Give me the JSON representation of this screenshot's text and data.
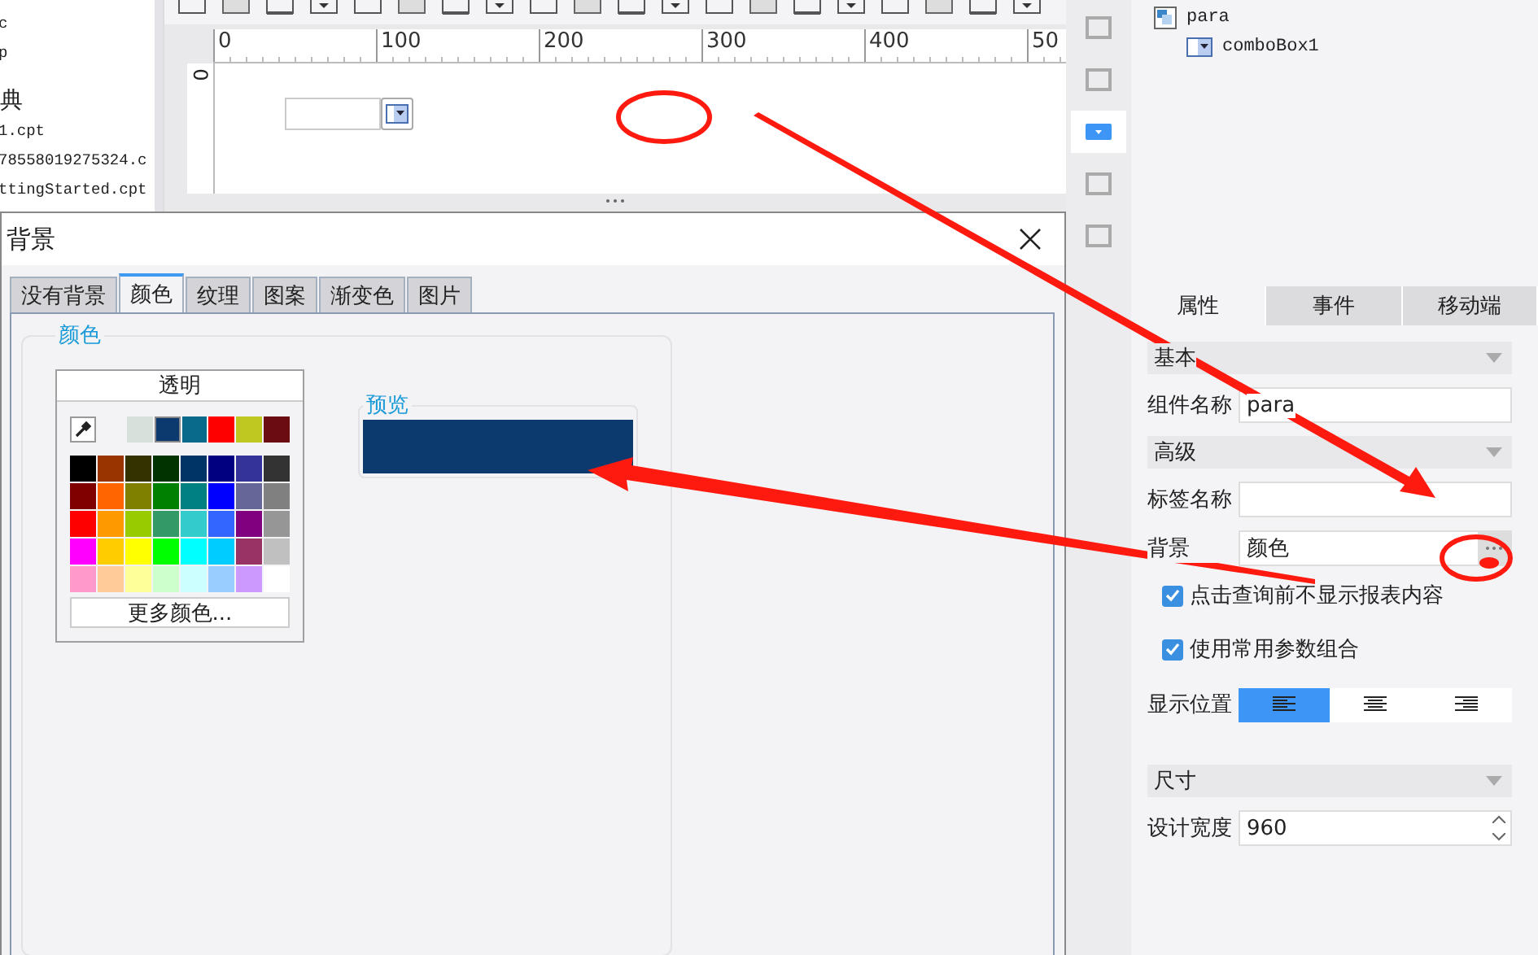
{
  "file_list": {
    "items": [
      "c",
      "p",
      "典",
      "1.cpt",
      "78558019275324.c",
      "ttingStarted.cpt"
    ]
  },
  "ruler": {
    "labels": [
      "0",
      "100",
      "200",
      "300",
      "400",
      "50"
    ],
    "vertical_label": "0"
  },
  "widget_strip": [
    {
      "selected": false
    },
    {
      "selected": false
    },
    {
      "selected": true
    },
    {
      "selected": false
    },
    {
      "selected": false
    }
  ],
  "tree": [
    {
      "label": "para",
      "children": [
        {
          "label": "comboBox1"
        }
      ]
    }
  ],
  "panel_tabs": [
    {
      "label": "属性",
      "selected": true
    },
    {
      "label": "事件",
      "selected": false
    },
    {
      "label": "移动端",
      "selected": false
    }
  ],
  "sections": [
    {
      "title": "基本",
      "expanded": true,
      "rows": [
        {
          "kind": "text",
          "label": "组件名称",
          "value": "para"
        }
      ]
    },
    {
      "title": "高级",
      "expanded": true,
      "rows": [
        {
          "kind": "text",
          "label": "标签名称"
        },
        {
          "kind": "picker",
          "label": "背景",
          "value": "颜色"
        },
        {
          "kind": "checkbox",
          "label": "点击查询前不显示报表内容",
          "checked": true
        },
        {
          "kind": "checkbox",
          "label": "使用常用参数组合",
          "checked": true
        },
        {
          "kind": "align",
          "label": "显示位置",
          "options": [
            {
              "selected": true
            },
            {
              "selected": false
            },
            {
              "selected": false
            }
          ]
        }
      ]
    },
    {
      "title": "尺寸",
      "expanded": true,
      "rows": [
        {
          "kind": "spinner",
          "label": "设计宽度",
          "value": "960"
        }
      ]
    }
  ],
  "dialog": {
    "title": "背景",
    "tabs": [
      {
        "label": "没有背景",
        "selected": false
      },
      {
        "label": "颜色",
        "selected": true
      },
      {
        "label": "纹理",
        "selected": false
      },
      {
        "label": "图案",
        "selected": false
      },
      {
        "label": "渐变色",
        "selected": false
      },
      {
        "label": "图片",
        "selected": false
      }
    ],
    "group_title": "颜色",
    "transparent_button": "透明",
    "recent_colors": [
      {
        "color": "#d8e0dc",
        "selected": false
      },
      {
        "color": "#0d3a6e",
        "selected": true
      },
      {
        "color": "#0a6a8c",
        "selected": false
      },
      {
        "color": "#ff0000",
        "selected": false
      },
      {
        "color": "#bec820",
        "selected": false
      },
      {
        "color": "#6a0c10",
        "selected": false
      }
    ],
    "palette": [
      [
        {
          "color": "#000000"
        },
        {
          "color": "#993300"
        },
        {
          "color": "#333300"
        },
        {
          "color": "#003300"
        },
        {
          "color": "#003366"
        },
        {
          "color": "#000080"
        },
        {
          "color": "#333399"
        },
        {
          "color": "#333333"
        }
      ],
      [
        {
          "color": "#800000"
        },
        {
          "color": "#ff6600"
        },
        {
          "color": "#808000"
        },
        {
          "color": "#008000"
        },
        {
          "color": "#008080"
        },
        {
          "color": "#0000ff"
        },
        {
          "color": "#666699"
        },
        {
          "color": "#808080"
        }
      ],
      [
        {
          "color": "#ff0000"
        },
        {
          "color": "#ff9900"
        },
        {
          "color": "#99cc00"
        },
        {
          "color": "#339966"
        },
        {
          "color": "#33cccc"
        },
        {
          "color": "#3366ff"
        },
        {
          "color": "#800080"
        },
        {
          "color": "#969696"
        }
      ],
      [
        {
          "color": "#ff00ff"
        },
        {
          "color": "#ffcc00"
        },
        {
          "color": "#ffff00"
        },
        {
          "color": "#00ff00"
        },
        {
          "color": "#00ffff"
        },
        {
          "color": "#00ccff"
        },
        {
          "color": "#993366"
        },
        {
          "color": "#c0c0c0"
        }
      ],
      [
        {
          "color": "#ff99cc"
        },
        {
          "color": "#ffcc99"
        },
        {
          "color": "#ffff99"
        },
        {
          "color": "#ccffcc"
        },
        {
          "color": "#ccffff"
        },
        {
          "color": "#99ccff"
        },
        {
          "color": "#cc99ff"
        },
        {
          "color": "#ffffff"
        }
      ]
    ],
    "more_colors_button": "更多颜色...",
    "preview": {
      "title": "预览",
      "color": "#0d3a6e"
    }
  }
}
